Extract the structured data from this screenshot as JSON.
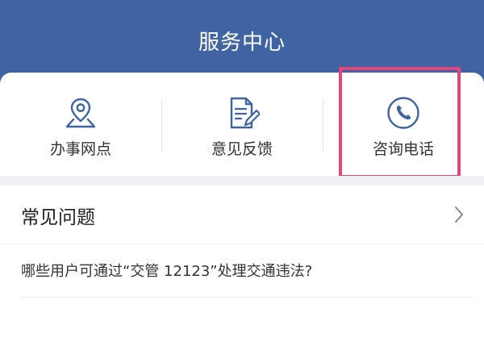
{
  "header": {
    "title": "服务中心"
  },
  "services": [
    {
      "label": "办事网点",
      "icon": "location-map-icon"
    },
    {
      "label": "意见反馈",
      "icon": "feedback-document-icon"
    },
    {
      "label": "咨询电话",
      "icon": "phone-icon"
    }
  ],
  "faq": {
    "title": "常见问题",
    "items": [
      {
        "text": "哪些用户可通过“交管 12123”处理交通违法?"
      }
    ]
  },
  "colors": {
    "header_bg": "#3f63a3",
    "icon_stroke": "#3f63a3",
    "highlight_border": "#e8447a",
    "band_bg": "#eff1f6"
  }
}
